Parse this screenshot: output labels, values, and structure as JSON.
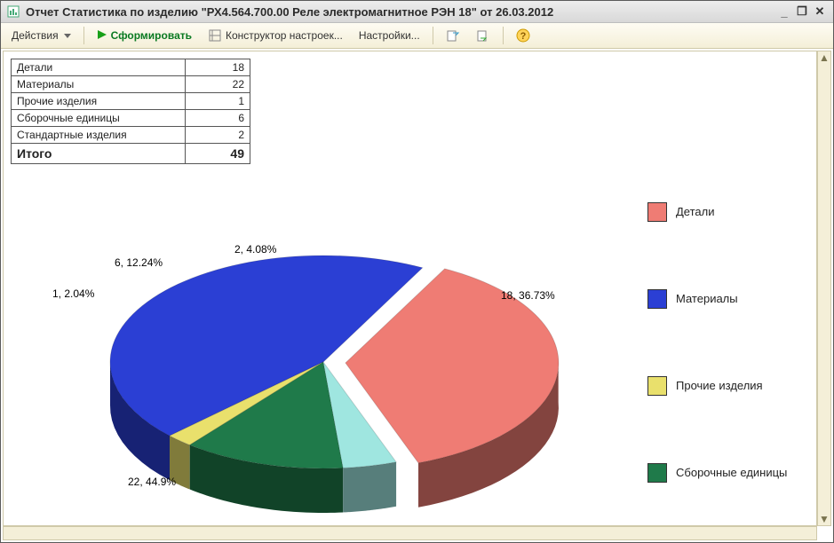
{
  "window": {
    "title": "Отчет Статистика по изделию \"РХ4.564.700.00 Реле электромагнитное РЭН 18\" от 26.03.2012"
  },
  "toolbar": {
    "actions_label": "Действия",
    "form_label": "Сформировать",
    "constructor_label": "Конструктор настроек...",
    "settings_label": "Настройки..."
  },
  "table": {
    "rows": [
      {
        "label": "Детали",
        "value": "18"
      },
      {
        "label": "Материалы",
        "value": "22"
      },
      {
        "label": "Прочие изделия",
        "value": "1"
      },
      {
        "label": "Сборочные единицы",
        "value": "6"
      },
      {
        "label": "Стандартные изделия",
        "value": "2"
      }
    ],
    "total_label": "Итого",
    "total_value": "49"
  },
  "legend": {
    "items": [
      {
        "label": "Детали",
        "color": "#ef7c74"
      },
      {
        "label": "Материалы",
        "color": "#2b3fd4"
      },
      {
        "label": "Прочие изделия",
        "color": "#e9e06c"
      },
      {
        "label": "Сборочные единицы",
        "color": "#1f7a4a"
      }
    ]
  },
  "slice_labels": {
    "s0": "18, 36.73%",
    "s1": "22, 44.9%",
    "s2": "1, 2.04%",
    "s3": "6, 12.24%",
    "s4": "2, 4.08%"
  },
  "chart_data": {
    "type": "pie",
    "categories": [
      "Детали",
      "Материалы",
      "Прочие изделия",
      "Сборочные единицы",
      "Стандартные изделия"
    ],
    "values": [
      18,
      22,
      1,
      6,
      2
    ],
    "percents": [
      36.73,
      44.9,
      2.04,
      12.24,
      4.08
    ],
    "colors": [
      "#ef7c74",
      "#2b3fd4",
      "#e9e06c",
      "#1f7a4a",
      "#9fe6e0"
    ],
    "title": "",
    "legend_position": "right",
    "exploded_slice_index": 0,
    "style_3d": true
  }
}
